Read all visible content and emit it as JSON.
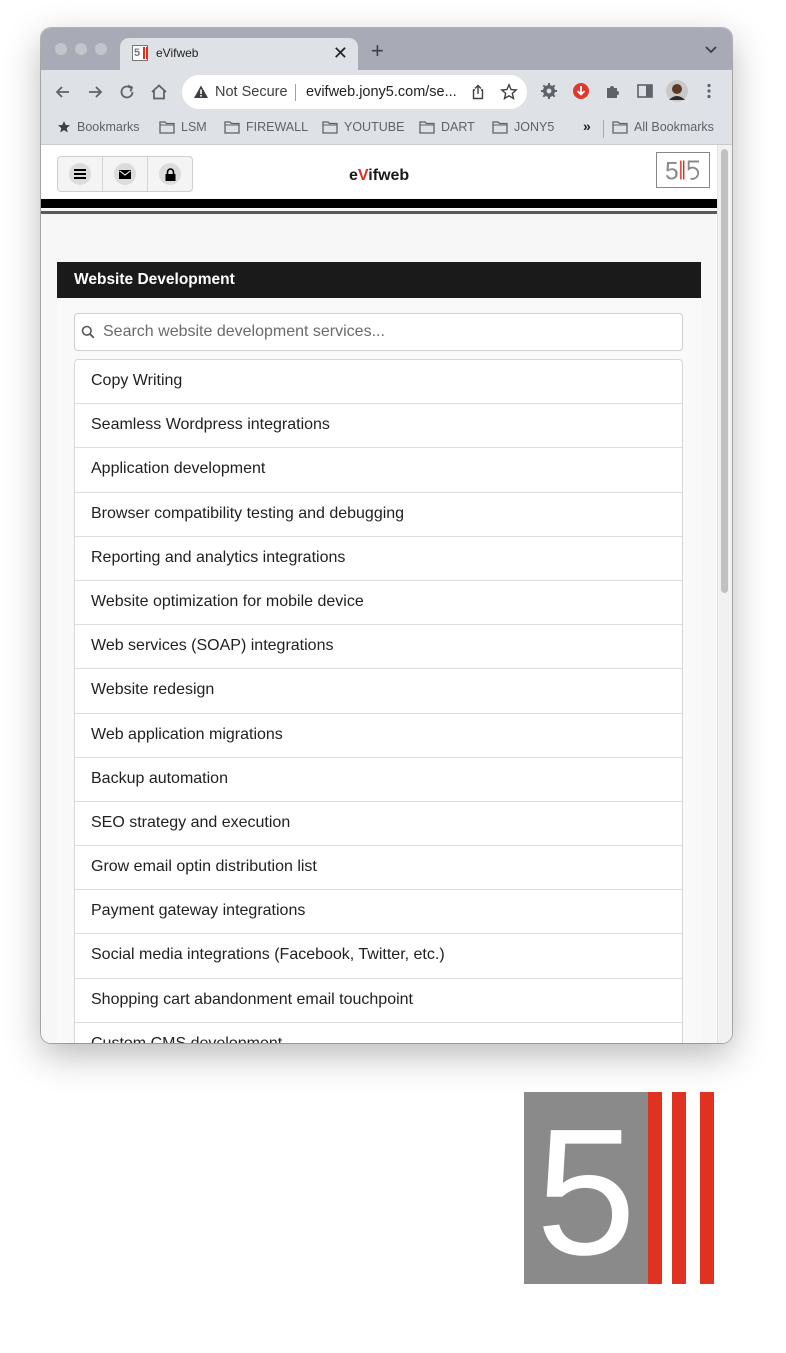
{
  "browser": {
    "tab_title": "eVifweb",
    "address": {
      "security_label": "Not Secure",
      "url": "evifweb.jony5.com/se..."
    },
    "bookmarks": [
      {
        "label": "Bookmarks",
        "icon": "star-icon"
      },
      {
        "label": "LSM",
        "icon": "folder-icon"
      },
      {
        "label": "FIREWALL",
        "icon": "folder-icon"
      },
      {
        "label": "YOUTUBE",
        "icon": "folder-icon"
      },
      {
        "label": "DART",
        "icon": "folder-icon"
      },
      {
        "label": "JONY5",
        "icon": "folder-icon"
      }
    ],
    "bookmarks_overflow": "»",
    "all_bookmarks": "All Bookmarks"
  },
  "site": {
    "title_prefix": "e",
    "title_accent": "V",
    "title_suffix": "ifweb",
    "accent_color": "#d9311f",
    "header_buttons": [
      "menu-icon",
      "mail-icon",
      "lock-icon"
    ]
  },
  "panel": {
    "title": "Website Development",
    "search_placeholder": "Search website development services...",
    "items": [
      "Copy Writing",
      "Seamless Wordpress integrations",
      "Application development",
      "Browser compatibility testing and debugging",
      "Reporting and analytics integrations",
      "Website optimization for mobile device",
      "Web services (SOAP) integrations",
      "Website redesign",
      "Web application migrations",
      "Backup automation",
      "SEO strategy and execution",
      "Grow email optin distribution list",
      "Payment gateway integrations",
      "Social media integrations (Facebook, Twitter, etc.)",
      "Shopping cart abandonment email touchpoint",
      "Custom CMS development"
    ]
  },
  "logo": {
    "numeral": "5",
    "gray": "#8a8a8a",
    "red": "#e03220"
  }
}
